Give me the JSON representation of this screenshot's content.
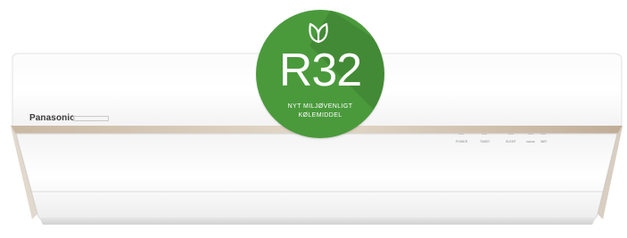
{
  "product": {
    "brand": "Panasonic",
    "indicators": [
      "POWER",
      "TIMER",
      "SLEEP",
      "nanoe",
      "WIFI"
    ]
  },
  "badge": {
    "refrigerant": "R32",
    "line1": "NYT MILJØVENLIGT",
    "line2": "KØLEMIDDEL",
    "icon": "leaf-icon",
    "color": "#4a9a3c"
  }
}
